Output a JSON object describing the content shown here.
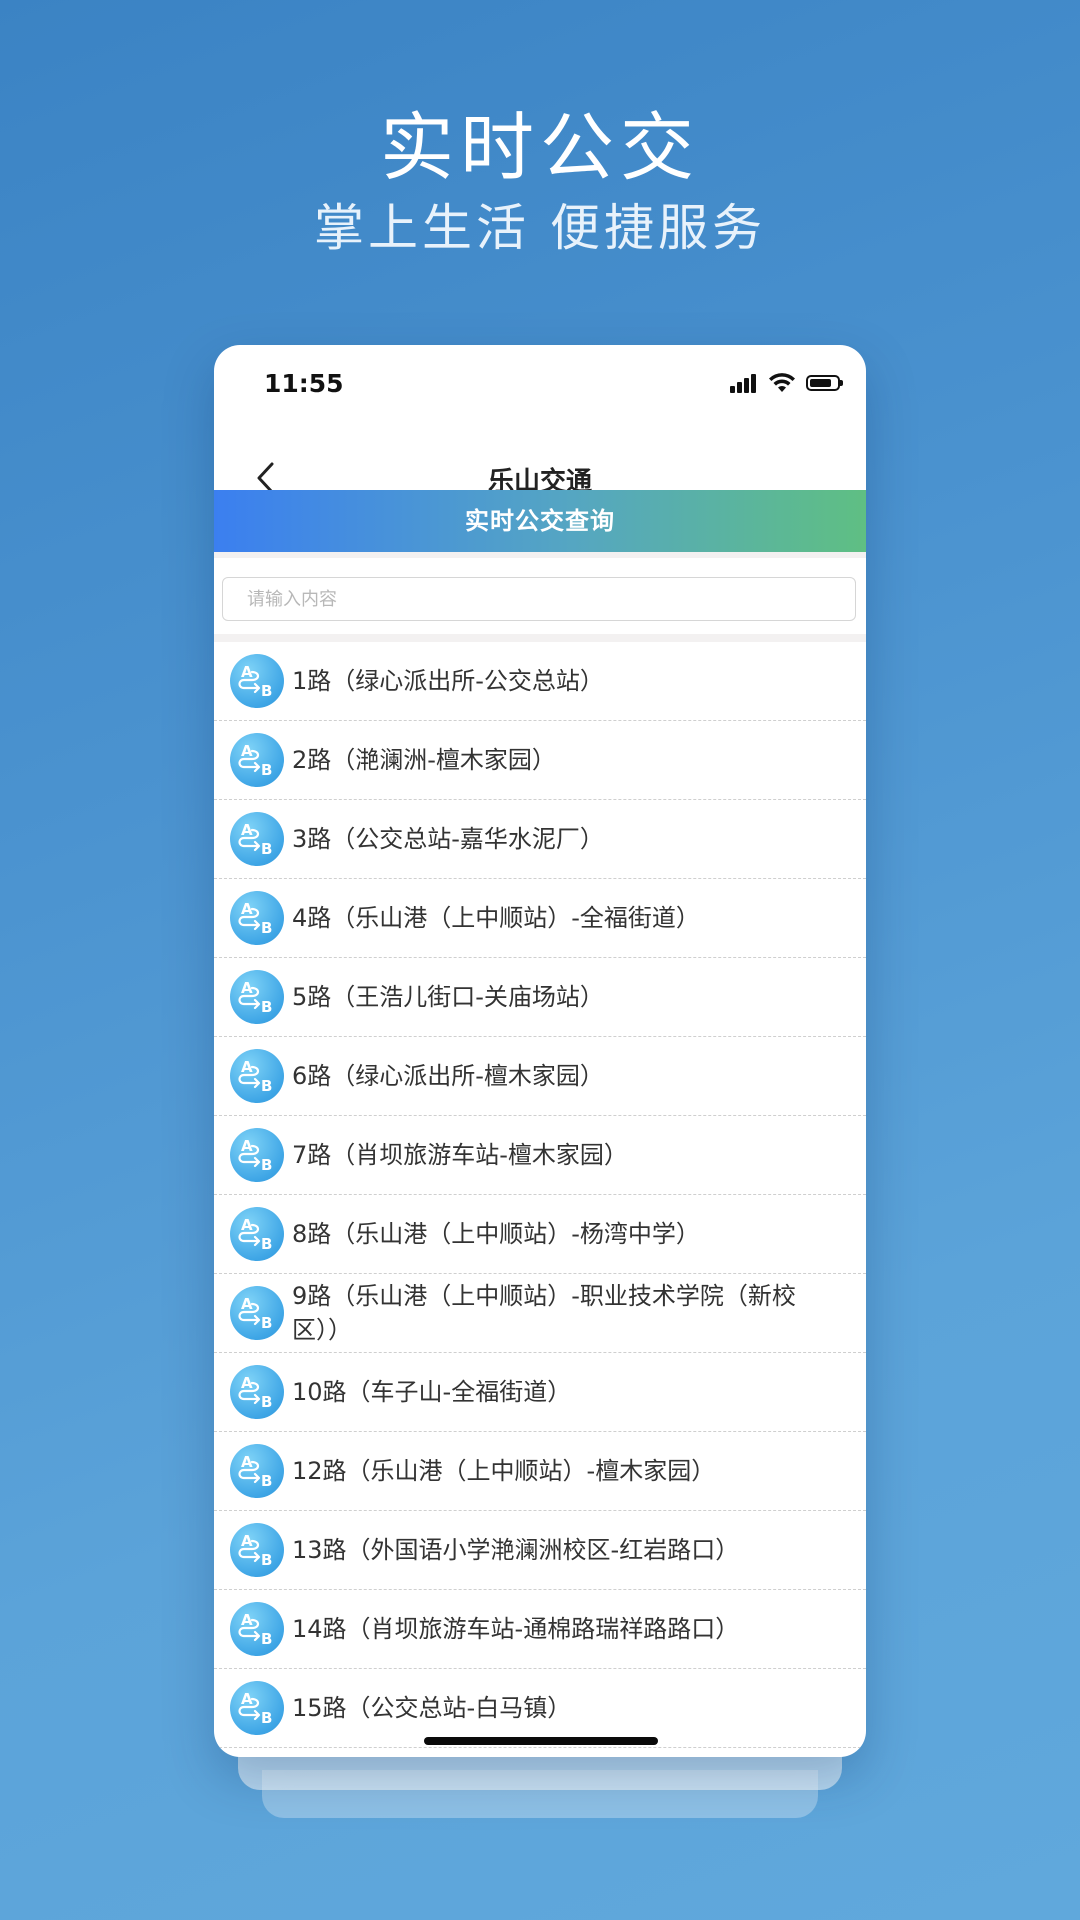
{
  "promo": {
    "title": "实时公交",
    "subtitle": "掌上生活 便捷服务"
  },
  "status_bar": {
    "time": "11:55"
  },
  "nav": {
    "title": "乐山交通"
  },
  "section": {
    "header": "实时公交查询"
  },
  "search": {
    "placeholder": "请输入内容",
    "value": ""
  },
  "routes": [
    "1路（绿心派出所-公交总站）",
    "2路（滟澜洲-檀木家园）",
    "3路（公交总站-嘉华水泥厂）",
    "4路（乐山港（上中顺站）-全福街道）",
    "5路（王浩儿街口-关庙场站）",
    "6路（绿心派出所-檀木家园）",
    "7路（肖坝旅游车站-檀木家园）",
    "8路（乐山港（上中顺站）-杨湾中学）",
    "9路（乐山港（上中顺站）-职业技术学院（新校区））",
    "10路（车子山-全福街道）",
    "12路（乐山港（上中顺站）-檀木家园）",
    "13路（外国语小学滟澜洲校区-红岩路口）",
    "14路（肖坝旅游车站-通棉路瑞祥路路口）",
    "15路（公交总站-白马镇）"
  ],
  "icons": {
    "route": "route-ab-icon",
    "back": "chevron-left-icon",
    "signal": "signal-icon",
    "wifi": "wifi-icon",
    "battery": "battery-icon"
  },
  "colors": {
    "background": "#4a92cf",
    "header_gradient_start": "#3b7ff0",
    "header_gradient_end": "#5fbf83",
    "route_icon": "#3fa6e6"
  }
}
